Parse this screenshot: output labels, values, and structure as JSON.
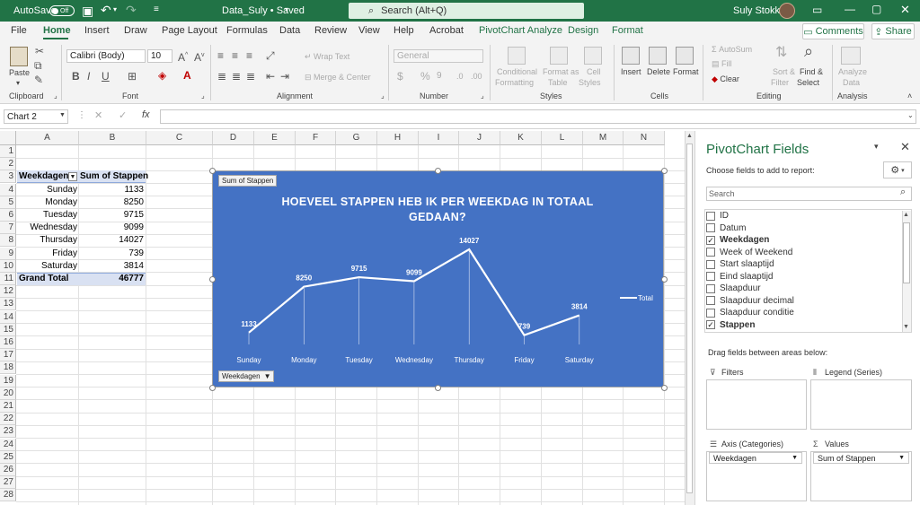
{
  "titlebar": {
    "autosave_label": "AutoSave",
    "autosave_state": "Off",
    "file_title": "Data_Suly • Saved",
    "search_placeholder": "Search (Alt+Q)",
    "user_name": "Suly Stokkel"
  },
  "tabs": [
    "File",
    "Home",
    "Insert",
    "Draw",
    "Page Layout",
    "Formulas",
    "Data",
    "Review",
    "View",
    "Help",
    "Acrobat",
    "PivotChart Analyze",
    "Design",
    "Format"
  ],
  "active_tab": "Home",
  "comments_label": "Comments",
  "share_label": "Share",
  "ribbon": {
    "clipboard": {
      "paste": "Paste",
      "group": "Clipboard"
    },
    "font": {
      "name": "Calibri (Body)",
      "size": "10",
      "group": "Font",
      "bold": "B",
      "italic": "I",
      "underline": "U"
    },
    "alignment": {
      "wrap": "Wrap Text",
      "merge": "Merge & Center",
      "group": "Alignment"
    },
    "number": {
      "format": "General",
      "group": "Number"
    },
    "styles": {
      "conditional": "Conditional",
      "conditional2": "Formatting",
      "format_as": "Format as",
      "table": "Table",
      "cell": "Cell",
      "styles_lbl": "Styles",
      "group": "Styles"
    },
    "cells": {
      "insert": "Insert",
      "delete": "Delete",
      "format": "Format",
      "group": "Cells"
    },
    "editing": {
      "autosum": "AutoSum",
      "fill": "Fill",
      "clear": "Clear",
      "sort": "Sort &",
      "filter": "Filter",
      "find": "Find &",
      "select": "Select",
      "group": "Editing"
    },
    "analysis": {
      "analyze": "Analyze",
      "data": "Data",
      "group": "Analysis"
    }
  },
  "formula_bar": {
    "name_box": "Chart 2",
    "formula": ""
  },
  "columns": [
    "A",
    "B",
    "C",
    "D",
    "E",
    "F",
    "G",
    "H",
    "I",
    "J",
    "K",
    "L",
    "M",
    "N"
  ],
  "rows": [
    "1",
    "2",
    "3",
    "4",
    "5",
    "6",
    "7",
    "8",
    "9",
    "10",
    "11",
    "12",
    "13",
    "14",
    "15",
    "16",
    "17",
    "18",
    "19",
    "20",
    "21",
    "22",
    "23",
    "24",
    "25",
    "26",
    "27",
    "28"
  ],
  "pivot_table": {
    "header_a": "Weekdagen",
    "header_b": "Sum of Stappen",
    "rows": [
      {
        "label": "Sunday",
        "value": "1133"
      },
      {
        "label": "Monday",
        "value": "8250"
      },
      {
        "label": "Tuesday",
        "value": "9715"
      },
      {
        "label": "Wednesday",
        "value": "9099"
      },
      {
        "label": "Thursday",
        "value": "14027"
      },
      {
        "label": "Friday",
        "value": "739"
      },
      {
        "label": "Saturday",
        "value": "3814"
      }
    ],
    "total_label": "Grand Total",
    "total_value": "46777"
  },
  "chart_data": {
    "type": "line",
    "title": "HOEVEEL STAPPEN HEB IK PER WEEKDAG IN TOTAAL GEDAAN?",
    "categories": [
      "Sunday",
      "Monday",
      "Tuesday",
      "Wednesday",
      "Thursday",
      "Friday",
      "Saturday"
    ],
    "series": [
      {
        "name": "Total",
        "values": [
          1133,
          8250,
          9715,
          9099,
          14027,
          739,
          3814
        ]
      }
    ],
    "value_button": "Sum of Stappen",
    "axis_button": "Weekdagen",
    "legend_position": "right",
    "grid": false,
    "colors": {
      "background": "#4472c4",
      "line": "#ffffff"
    }
  },
  "pane": {
    "title": "PivotChart Fields",
    "subtitle": "Choose fields to add to report:",
    "search_placeholder": "Search",
    "fields": [
      {
        "name": "ID",
        "checked": false
      },
      {
        "name": "Datum",
        "checked": false
      },
      {
        "name": "Weekdagen",
        "checked": true
      },
      {
        "name": "Week of Weekend",
        "checked": false
      },
      {
        "name": "Start slaaptijd",
        "checked": false
      },
      {
        "name": "Eind slaaptijd",
        "checked": false
      },
      {
        "name": "Slaapduur",
        "checked": false
      },
      {
        "name": "Slaapduur decimal",
        "checked": false
      },
      {
        "name": "Slaapduur conditie",
        "checked": false
      },
      {
        "name": "Stappen",
        "checked": true
      }
    ],
    "drag_label": "Drag fields between areas below:",
    "filters_label": "Filters",
    "legend_label": "Legend (Series)",
    "axis_label": "Axis (Categories)",
    "values_label": "Values",
    "axis_item": "Weekdagen",
    "values_item": "Sum of Stappen"
  },
  "colors": {
    "brand": "#217346",
    "chart_bg": "#4472c4",
    "table_header": "#d9e1f2"
  }
}
